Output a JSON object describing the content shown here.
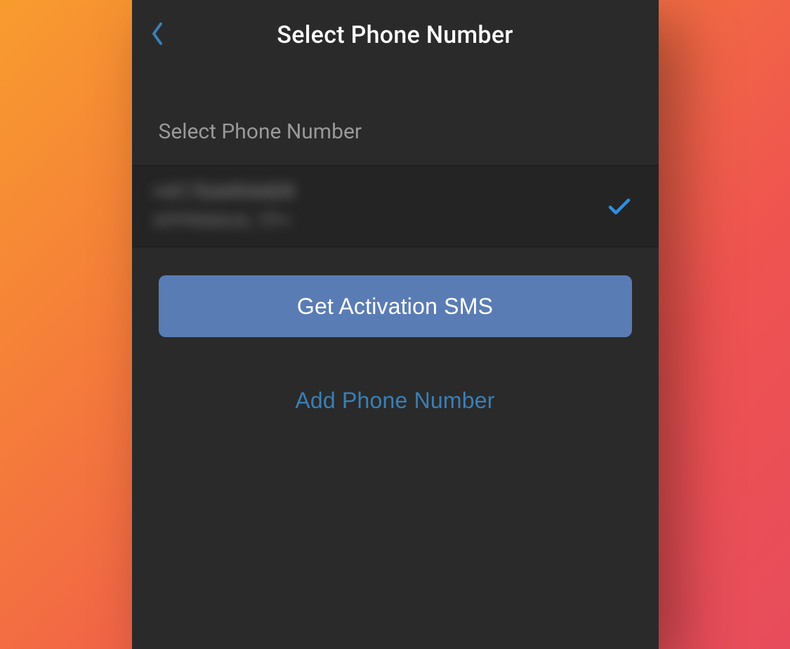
{
  "header": {
    "title": "Select Phone Number"
  },
  "section": {
    "label": "Select Phone Number"
  },
  "phone_item": {
    "number_obscured": "+41764494409",
    "label_obscured": "APPRIMAAL TP+",
    "selected": true
  },
  "actions": {
    "primary_label": "Get Activation SMS",
    "add_label": "Add Phone Number"
  },
  "colors": {
    "panel_bg": "#2a2a2a",
    "row_bg": "#242424",
    "primary_button": "#5a7cb5",
    "link": "#3a7fb5",
    "back_arrow": "#3a7fb5",
    "check": "#2f8ee0"
  }
}
